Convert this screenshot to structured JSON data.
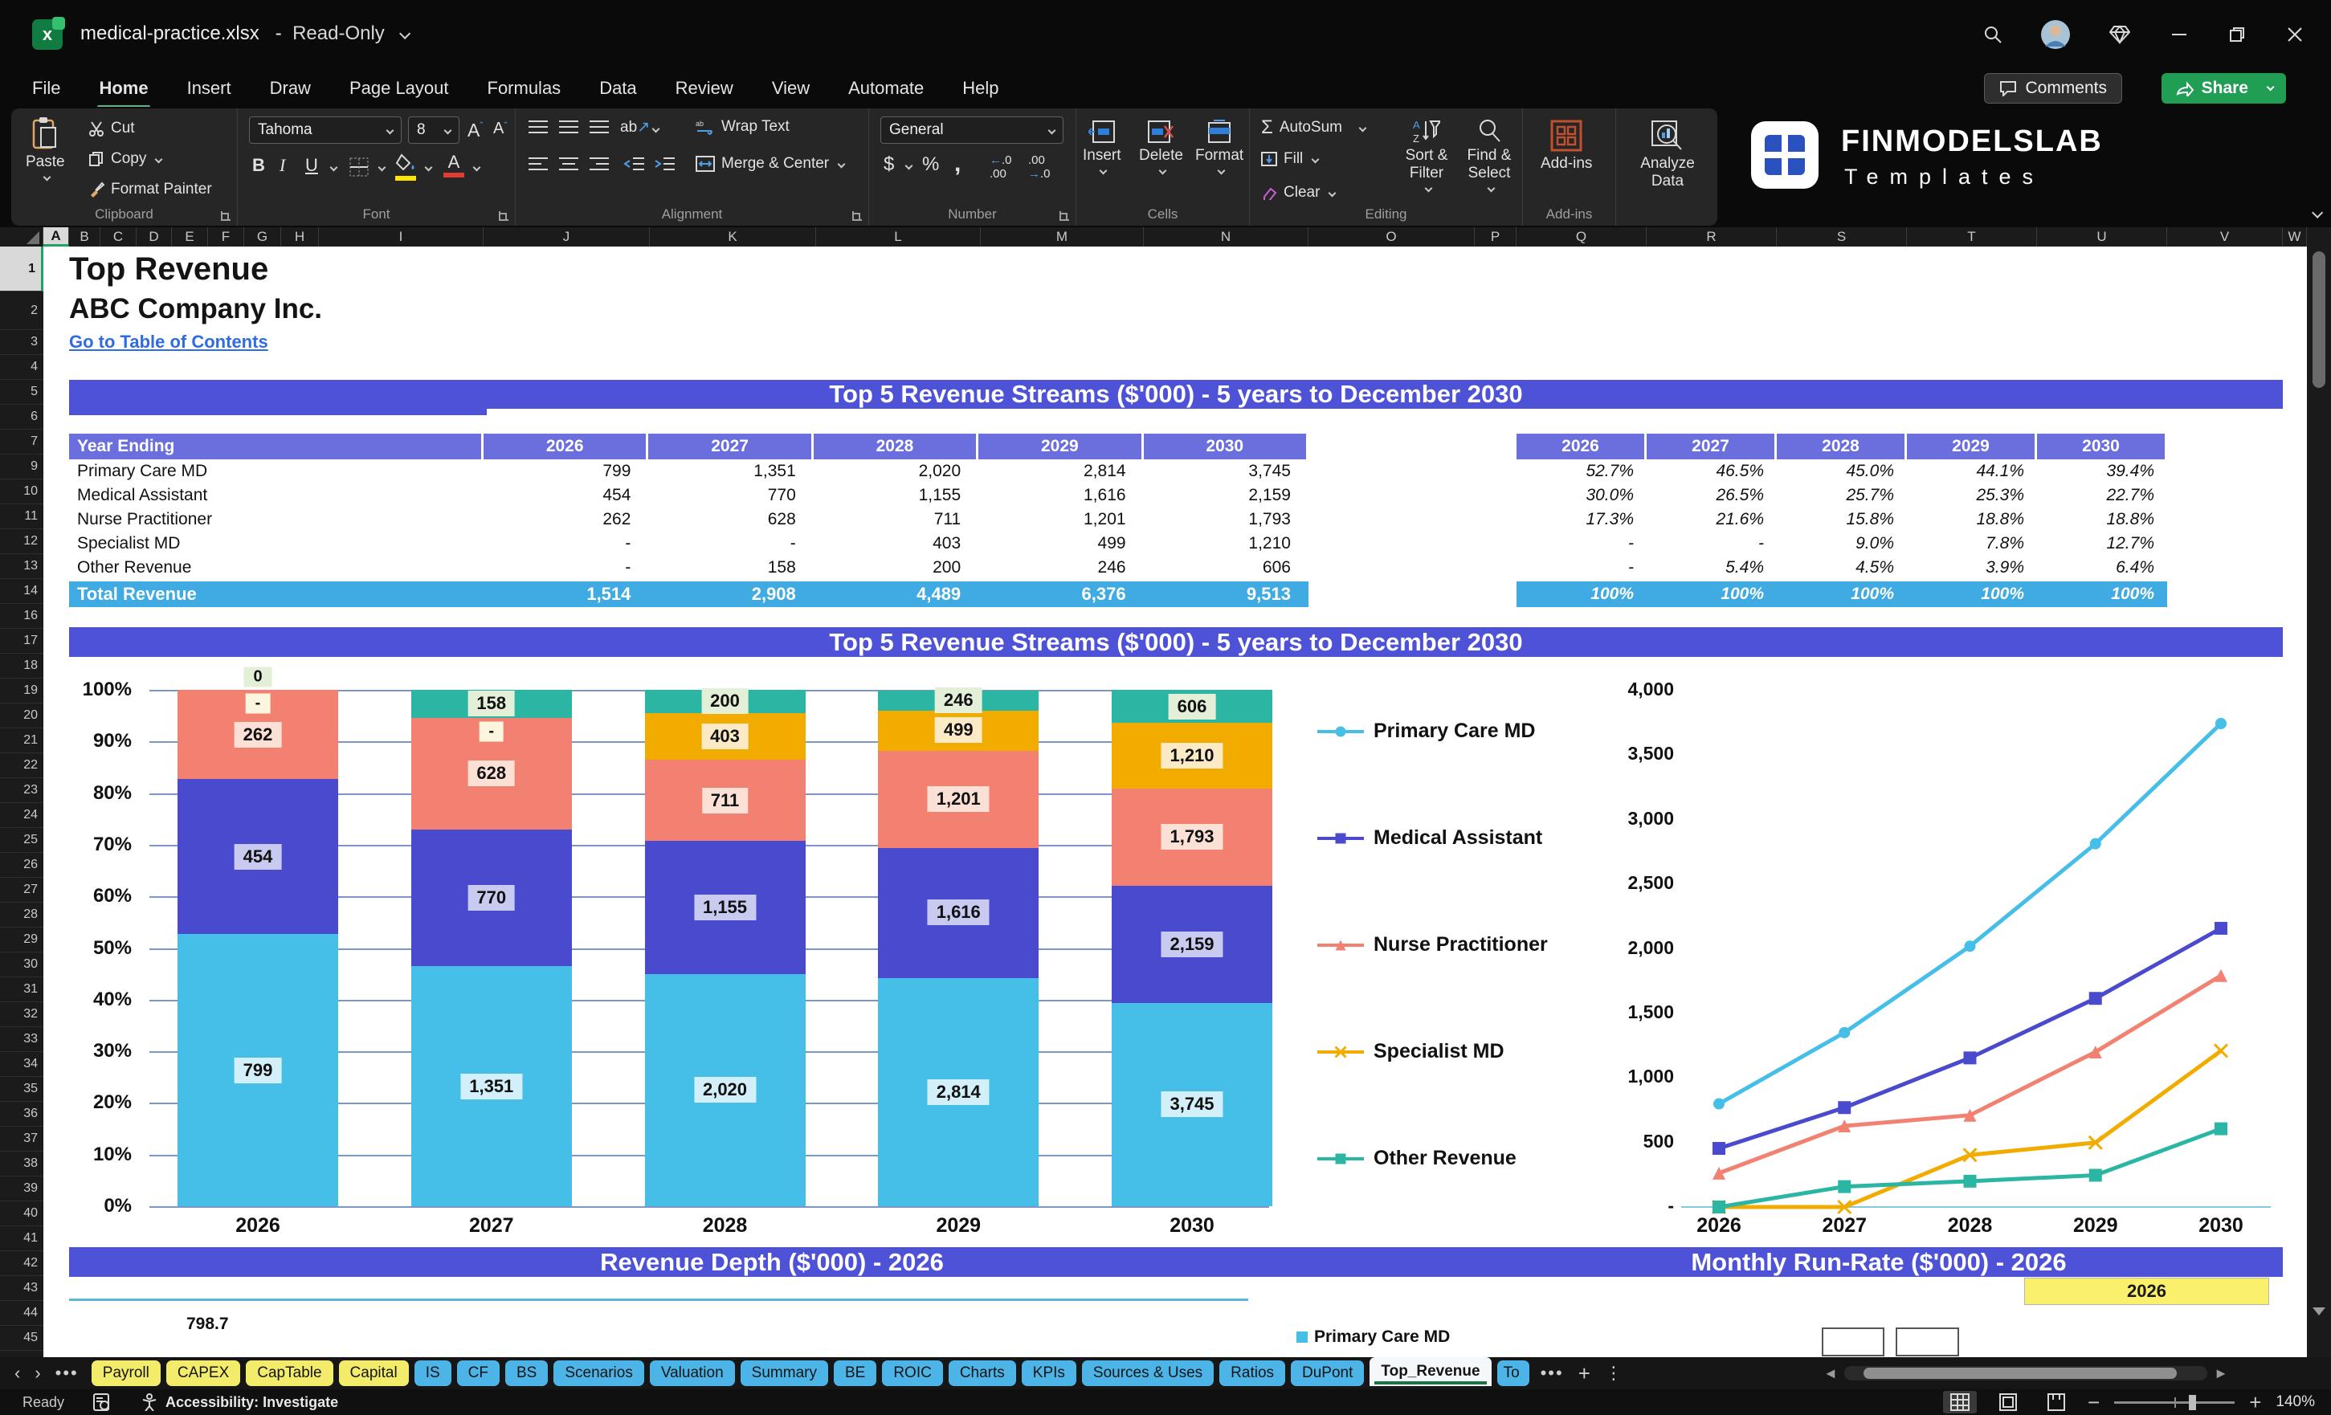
{
  "window": {
    "file": "medical-practice.xlsx",
    "separator": "-",
    "mode": "Read-Only"
  },
  "menu": {
    "items": [
      "File",
      "Home",
      "Insert",
      "Draw",
      "Page Layout",
      "Formulas",
      "Data",
      "Review",
      "View",
      "Automate",
      "Help"
    ],
    "active": "Home"
  },
  "actions": {
    "comments": "Comments",
    "share": "Share"
  },
  "ribbon": {
    "clipboard": {
      "paste": "Paste",
      "cut": "Cut",
      "copy": "Copy",
      "format_painter": "Format Painter",
      "group": "Clipboard"
    },
    "font": {
      "family": "Tahoma",
      "size": "8",
      "group": "Font"
    },
    "alignment": {
      "wrap": "Wrap Text",
      "merge": "Merge & Center",
      "group": "Alignment"
    },
    "number": {
      "format": "General",
      "group": "Number"
    },
    "cells": {
      "insert": "Insert",
      "delete": "Delete",
      "format": "Format",
      "group": "Cells"
    },
    "editing": {
      "autosum": "AutoSum",
      "fill": "Fill",
      "clear": "Clear",
      "sort": "Sort & Filter",
      "find": "Find & Select",
      "group": "Editing"
    },
    "addins": {
      "label": "Add-ins",
      "group": "Add-ins"
    },
    "analyze": {
      "label": "Analyze Data"
    }
  },
  "logo": {
    "title": "FINMODELSLAB",
    "subtitle": "Templates"
  },
  "grid": {
    "columns": [
      "A",
      "B",
      "C",
      "D",
      "E",
      "F",
      "G",
      "H",
      "I",
      "J",
      "K",
      "L",
      "M",
      "N",
      "O",
      "P",
      "Q",
      "R",
      "S",
      "T",
      "U",
      "V",
      "W"
    ],
    "rows": [
      1,
      2,
      3,
      4,
      5,
      6,
      7,
      9,
      10,
      11,
      12,
      13,
      14,
      16,
      17,
      18,
      19,
      20,
      21,
      22,
      23,
      24,
      25,
      26,
      27,
      28,
      29,
      30,
      31,
      32,
      33,
      34,
      35,
      36,
      37,
      38,
      39,
      40,
      41,
      42,
      43,
      44,
      45
    ]
  },
  "doc": {
    "title": "Top Revenue",
    "subtitle": "ABC Company Inc.",
    "link": "Go to Table of Contents"
  },
  "banners": {
    "main1": "Top 5 Revenue Streams ($'000) - 5 years to December 2030",
    "main2": "Top 5 Revenue Streams ($'000) - 5 years to December 2030",
    "depth": "Revenue Depth ($'000) - 2026",
    "runrate": "Monthly Run-Rate ($'000) - 2026"
  },
  "table": {
    "header": "Year Ending",
    "years": [
      "2026",
      "2027",
      "2028",
      "2029",
      "2030"
    ],
    "rows": [
      {
        "name": "Primary Care MD",
        "values": [
          "799",
          "1,351",
          "2,020",
          "2,814",
          "3,745"
        ]
      },
      {
        "name": "Medical Assistant",
        "values": [
          "454",
          "770",
          "1,155",
          "1,616",
          "2,159"
        ]
      },
      {
        "name": "Nurse Practitioner",
        "values": [
          "262",
          "628",
          "711",
          "1,201",
          "1,793"
        ]
      },
      {
        "name": "Specialist MD",
        "values": [
          "-",
          "-",
          "403",
          "499",
          "1,210"
        ]
      },
      {
        "name": "Other Revenue",
        "values": [
          "-",
          "158",
          "200",
          "246",
          "606"
        ]
      }
    ],
    "total": {
      "label": "Total Revenue",
      "values": [
        "1,514",
        "2,908",
        "4,489",
        "6,376",
        "9,513"
      ]
    }
  },
  "pct_table": {
    "years": [
      "2026",
      "2027",
      "2028",
      "2029",
      "2030"
    ],
    "rows": [
      [
        "52.7%",
        "46.5%",
        "45.0%",
        "44.1%",
        "39.4%"
      ],
      [
        "30.0%",
        "26.5%",
        "25.7%",
        "25.3%",
        "22.7%"
      ],
      [
        "17.3%",
        "21.6%",
        "15.8%",
        "18.8%",
        "18.8%"
      ],
      [
        "-",
        "-",
        "9.0%",
        "7.8%",
        "12.7%"
      ],
      [
        "-",
        "5.4%",
        "4.5%",
        "3.9%",
        "6.4%"
      ]
    ],
    "total": [
      "100%",
      "100%",
      "100%",
      "100%",
      "100%"
    ]
  },
  "chart_data": [
    {
      "type": "bar",
      "subtype": "percent-stacked",
      "title": "Top 5 Revenue Streams ($'000) - 5 years to December 2030",
      "categories": [
        "2026",
        "2027",
        "2028",
        "2029",
        "2030"
      ],
      "yticks": [
        "100%",
        "90%",
        "80%",
        "70%",
        "60%",
        "50%",
        "40%",
        "30%",
        "20%",
        "10%",
        "0%"
      ],
      "grid": true,
      "series": [
        {
          "name": "Primary Care MD",
          "color": "#45BEE8",
          "label_bg": "#D2EFFA",
          "values": [
            799,
            1351,
            2020,
            2814,
            3745
          ],
          "labels": [
            "799",
            "1,351",
            "2,020",
            "2,814",
            "3,745"
          ],
          "pct": [
            52.7,
            46.5,
            45.0,
            44.1,
            39.4
          ]
        },
        {
          "name": "Medical Assistant",
          "color": "#4A4ACE",
          "label_bg": "#C9CAF0",
          "values": [
            454,
            770,
            1155,
            1616,
            2159
          ],
          "labels": [
            "454",
            "770",
            "1,155",
            "1,616",
            "2,159"
          ],
          "pct": [
            30.0,
            26.5,
            25.7,
            25.3,
            22.7
          ]
        },
        {
          "name": "Nurse Practitioner",
          "color": "#F28172",
          "label_bg": "#FBE0D5",
          "values": [
            262,
            628,
            711,
            1201,
            1793
          ],
          "labels": [
            "262",
            "628",
            "711",
            "1,201",
            "1,793"
          ],
          "pct": [
            17.3,
            21.6,
            15.8,
            18.8,
            18.8
          ]
        },
        {
          "name": "Specialist MD",
          "color": "#F2AC00",
          "label_bg": "#FBEAC5",
          "zero_bg": "#FCF6DE",
          "values": [
            0,
            0,
            403,
            499,
            1210
          ],
          "labels": [
            "-",
            "-",
            "403",
            "499",
            "1,210"
          ],
          "pct": [
            0,
            0,
            9.0,
            7.8,
            12.7
          ]
        },
        {
          "name": "Other Revenue",
          "color": "#2BB5A3",
          "label_bg": "#E4EFD8",
          "zero_bg": "#E4EFD8",
          "values": [
            0,
            158,
            200,
            246,
            606
          ],
          "labels": [
            "0",
            "158",
            "200",
            "246",
            "606"
          ],
          "pct": [
            0,
            5.4,
            4.5,
            3.9,
            6.4
          ]
        }
      ]
    },
    {
      "type": "line",
      "categories": [
        "2026",
        "2027",
        "2028",
        "2029",
        "2030"
      ],
      "ylim": [
        0,
        4000
      ],
      "yticks": [
        "4,000",
        "3,500",
        "3,000",
        "2,500",
        "2,000",
        "1,500",
        "1,000",
        "500",
        "-"
      ],
      "grid": false,
      "legend_position": "left",
      "series": [
        {
          "name": "Primary Care MD",
          "color": "#45BEE8",
          "marker": "circle",
          "values": [
            799,
            1351,
            2020,
            2814,
            3745
          ]
        },
        {
          "name": "Medical Assistant",
          "color": "#4A4ACE",
          "marker": "square",
          "values": [
            454,
            770,
            1155,
            1616,
            2159
          ]
        },
        {
          "name": "Nurse Practitioner",
          "color": "#F28172",
          "marker": "triangle",
          "values": [
            262,
            628,
            711,
            1201,
            1793
          ]
        },
        {
          "name": "Specialist MD",
          "color": "#F2AC00",
          "marker": "x",
          "values": [
            0,
            0,
            403,
            499,
            1210
          ]
        },
        {
          "name": "Other Revenue",
          "color": "#2BB5A3",
          "marker": "square",
          "values": [
            0,
            158,
            200,
            246,
            606
          ]
        }
      ]
    }
  ],
  "misc": {
    "year_cell": "2026",
    "partial_value": "798.7",
    "mini_legend": "Primary Care MD"
  },
  "tabs": {
    "list": [
      {
        "label": "Payroll",
        "type": "yellow"
      },
      {
        "label": "CAPEX",
        "type": "yellow"
      },
      {
        "label": "CapTable",
        "type": "yellow"
      },
      {
        "label": "Capital",
        "type": "yellow"
      },
      {
        "label": "IS",
        "type": "blue"
      },
      {
        "label": "CF",
        "type": "blue"
      },
      {
        "label": "BS",
        "type": "blue"
      },
      {
        "label": "Scenarios",
        "type": "blue"
      },
      {
        "label": "Valuation",
        "type": "blue"
      },
      {
        "label": "Summary",
        "type": "blue"
      },
      {
        "label": "BE",
        "type": "blue"
      },
      {
        "label": "ROIC",
        "type": "blue"
      },
      {
        "label": "Charts",
        "type": "blue"
      },
      {
        "label": "KPIs",
        "type": "blue"
      },
      {
        "label": "Sources & Uses",
        "type": "blue"
      },
      {
        "label": "Ratios",
        "type": "blue"
      },
      {
        "label": "DuPont",
        "type": "blue"
      },
      {
        "label": "Top_Revenue",
        "type": "active"
      },
      {
        "label": "To",
        "type": "blue partial"
      }
    ]
  },
  "status": {
    "ready": "Ready",
    "accessibility": "Accessibility: Investigate",
    "zoom": "140%"
  },
  "colors": {
    "banner": "#4E52D6",
    "table_header": "#6B6FDD",
    "total_row": "#3FABE2",
    "link": "#2E6BE4",
    "tab_yellow": "#F2EC6A",
    "tab_blue": "#4CB4E7",
    "share_green": "#1F9E54"
  }
}
